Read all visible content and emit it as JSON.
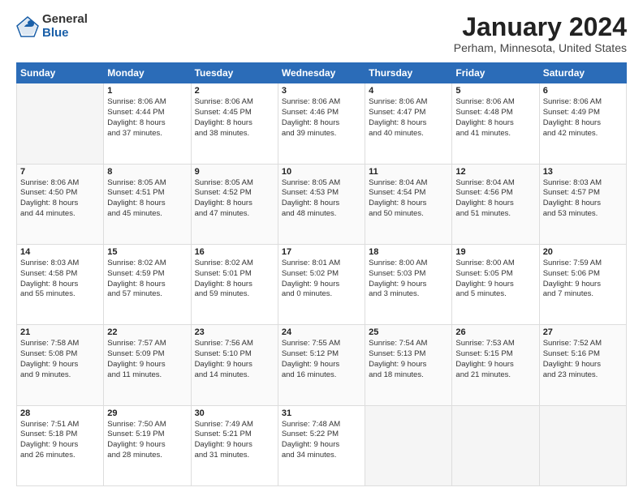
{
  "logo": {
    "general": "General",
    "blue": "Blue"
  },
  "header": {
    "title": "January 2024",
    "location": "Perham, Minnesota, United States"
  },
  "weekdays": [
    "Sunday",
    "Monday",
    "Tuesday",
    "Wednesday",
    "Thursday",
    "Friday",
    "Saturday"
  ],
  "weeks": [
    [
      {
        "day": "",
        "sunrise": "",
        "sunset": "",
        "daylight": "",
        "empty": true
      },
      {
        "day": "1",
        "sunrise": "Sunrise: 8:06 AM",
        "sunset": "Sunset: 4:44 PM",
        "daylight": "Daylight: 8 hours and 37 minutes."
      },
      {
        "day": "2",
        "sunrise": "Sunrise: 8:06 AM",
        "sunset": "Sunset: 4:45 PM",
        "daylight": "Daylight: 8 hours and 38 minutes."
      },
      {
        "day": "3",
        "sunrise": "Sunrise: 8:06 AM",
        "sunset": "Sunset: 4:46 PM",
        "daylight": "Daylight: 8 hours and 39 minutes."
      },
      {
        "day": "4",
        "sunrise": "Sunrise: 8:06 AM",
        "sunset": "Sunset: 4:47 PM",
        "daylight": "Daylight: 8 hours and 40 minutes."
      },
      {
        "day": "5",
        "sunrise": "Sunrise: 8:06 AM",
        "sunset": "Sunset: 4:48 PM",
        "daylight": "Daylight: 8 hours and 41 minutes."
      },
      {
        "day": "6",
        "sunrise": "Sunrise: 8:06 AM",
        "sunset": "Sunset: 4:49 PM",
        "daylight": "Daylight: 8 hours and 42 minutes."
      }
    ],
    [
      {
        "day": "7",
        "sunrise": "Sunrise: 8:06 AM",
        "sunset": "Sunset: 4:50 PM",
        "daylight": "Daylight: 8 hours and 44 minutes."
      },
      {
        "day": "8",
        "sunrise": "Sunrise: 8:05 AM",
        "sunset": "Sunset: 4:51 PM",
        "daylight": "Daylight: 8 hours and 45 minutes."
      },
      {
        "day": "9",
        "sunrise": "Sunrise: 8:05 AM",
        "sunset": "Sunset: 4:52 PM",
        "daylight": "Daylight: 8 hours and 47 minutes."
      },
      {
        "day": "10",
        "sunrise": "Sunrise: 8:05 AM",
        "sunset": "Sunset: 4:53 PM",
        "daylight": "Daylight: 8 hours and 48 minutes."
      },
      {
        "day": "11",
        "sunrise": "Sunrise: 8:04 AM",
        "sunset": "Sunset: 4:54 PM",
        "daylight": "Daylight: 8 hours and 50 minutes."
      },
      {
        "day": "12",
        "sunrise": "Sunrise: 8:04 AM",
        "sunset": "Sunset: 4:56 PM",
        "daylight": "Daylight: 8 hours and 51 minutes."
      },
      {
        "day": "13",
        "sunrise": "Sunrise: 8:03 AM",
        "sunset": "Sunset: 4:57 PM",
        "daylight": "Daylight: 8 hours and 53 minutes."
      }
    ],
    [
      {
        "day": "14",
        "sunrise": "Sunrise: 8:03 AM",
        "sunset": "Sunset: 4:58 PM",
        "daylight": "Daylight: 8 hours and 55 minutes."
      },
      {
        "day": "15",
        "sunrise": "Sunrise: 8:02 AM",
        "sunset": "Sunset: 4:59 PM",
        "daylight": "Daylight: 8 hours and 57 minutes."
      },
      {
        "day": "16",
        "sunrise": "Sunrise: 8:02 AM",
        "sunset": "Sunset: 5:01 PM",
        "daylight": "Daylight: 8 hours and 59 minutes."
      },
      {
        "day": "17",
        "sunrise": "Sunrise: 8:01 AM",
        "sunset": "Sunset: 5:02 PM",
        "daylight": "Daylight: 9 hours and 0 minutes."
      },
      {
        "day": "18",
        "sunrise": "Sunrise: 8:00 AM",
        "sunset": "Sunset: 5:03 PM",
        "daylight": "Daylight: 9 hours and 3 minutes."
      },
      {
        "day": "19",
        "sunrise": "Sunrise: 8:00 AM",
        "sunset": "Sunset: 5:05 PM",
        "daylight": "Daylight: 9 hours and 5 minutes."
      },
      {
        "day": "20",
        "sunrise": "Sunrise: 7:59 AM",
        "sunset": "Sunset: 5:06 PM",
        "daylight": "Daylight: 9 hours and 7 minutes."
      }
    ],
    [
      {
        "day": "21",
        "sunrise": "Sunrise: 7:58 AM",
        "sunset": "Sunset: 5:08 PM",
        "daylight": "Daylight: 9 hours and 9 minutes."
      },
      {
        "day": "22",
        "sunrise": "Sunrise: 7:57 AM",
        "sunset": "Sunset: 5:09 PM",
        "daylight": "Daylight: 9 hours and 11 minutes."
      },
      {
        "day": "23",
        "sunrise": "Sunrise: 7:56 AM",
        "sunset": "Sunset: 5:10 PM",
        "daylight": "Daylight: 9 hours and 14 minutes."
      },
      {
        "day": "24",
        "sunrise": "Sunrise: 7:55 AM",
        "sunset": "Sunset: 5:12 PM",
        "daylight": "Daylight: 9 hours and 16 minutes."
      },
      {
        "day": "25",
        "sunrise": "Sunrise: 7:54 AM",
        "sunset": "Sunset: 5:13 PM",
        "daylight": "Daylight: 9 hours and 18 minutes."
      },
      {
        "day": "26",
        "sunrise": "Sunrise: 7:53 AM",
        "sunset": "Sunset: 5:15 PM",
        "daylight": "Daylight: 9 hours and 21 minutes."
      },
      {
        "day": "27",
        "sunrise": "Sunrise: 7:52 AM",
        "sunset": "Sunset: 5:16 PM",
        "daylight": "Daylight: 9 hours and 23 minutes."
      }
    ],
    [
      {
        "day": "28",
        "sunrise": "Sunrise: 7:51 AM",
        "sunset": "Sunset: 5:18 PM",
        "daylight": "Daylight: 9 hours and 26 minutes."
      },
      {
        "day": "29",
        "sunrise": "Sunrise: 7:50 AM",
        "sunset": "Sunset: 5:19 PM",
        "daylight": "Daylight: 9 hours and 28 minutes."
      },
      {
        "day": "30",
        "sunrise": "Sunrise: 7:49 AM",
        "sunset": "Sunset: 5:21 PM",
        "daylight": "Daylight: 9 hours and 31 minutes."
      },
      {
        "day": "31",
        "sunrise": "Sunrise: 7:48 AM",
        "sunset": "Sunset: 5:22 PM",
        "daylight": "Daylight: 9 hours and 34 minutes."
      },
      {
        "day": "",
        "sunrise": "",
        "sunset": "",
        "daylight": "",
        "empty": true
      },
      {
        "day": "",
        "sunrise": "",
        "sunset": "",
        "daylight": "",
        "empty": true
      },
      {
        "day": "",
        "sunrise": "",
        "sunset": "",
        "daylight": "",
        "empty": true
      }
    ]
  ]
}
